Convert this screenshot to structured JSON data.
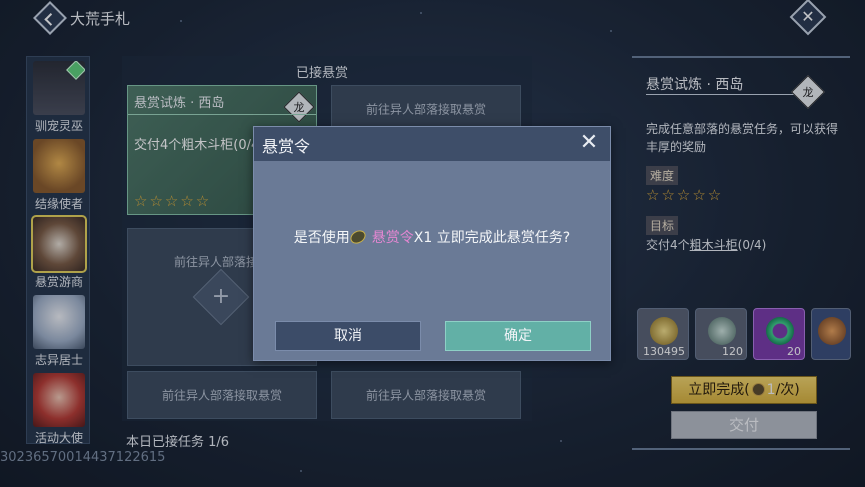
{
  "header": {
    "title": "大荒手札"
  },
  "sidebar": {
    "items": [
      {
        "label": "驯宠灵巫",
        "color": "#3a3d48"
      },
      {
        "label": "结缘使者",
        "color": "#c28a3a"
      },
      {
        "label": "悬赏游商",
        "color": "#8b6a4a"
      },
      {
        "label": "志异居士",
        "color": "#9fb0c8"
      },
      {
        "label": "活动大使",
        "color": "#b83a32"
      }
    ]
  },
  "bounty": {
    "section_title": "已接悬赏",
    "active_card": {
      "title": "悬赏试炼 · 西岛",
      "emblem": "龙",
      "task": "交付4个粗木斗柜(0/4",
      "stars": "☆☆☆☆☆"
    },
    "empty_slot_text": "前往异人部落接取悬赏",
    "empty_slot_text_cut": "前往异人部落接取",
    "plus": "+",
    "daily_count": "本日已接任务 1/6"
  },
  "uid": "3023657001443712261​5",
  "detail": {
    "title": "悬赏试炼 · 西岛",
    "emblem": "龙",
    "description": "完成任意部落的悬赏任务，可以获得丰厚的奖励",
    "difficulty_label": "难度",
    "stars": "☆☆☆☆☆",
    "goal_label": "目标",
    "task_prefix": "交付4个",
    "task_item": "粗木斗柜",
    "task_progress": "(0/4)",
    "rewards": [
      {
        "count": "130495",
        "color": "#c8b04a"
      },
      {
        "count": "120",
        "color": "#6f8f88"
      },
      {
        "count": "20",
        "color": "#3fcf8a"
      },
      {
        "count": "",
        "color": "#a5643a"
      }
    ],
    "complete_label_pre": "立即完成(",
    "complete_label_num": "1",
    "complete_label_post": "/次)",
    "submit_label": "交付"
  },
  "modal": {
    "title": "悬赏令",
    "close": "✕",
    "msg_pre": "是否使用",
    "msg_item": "悬赏令",
    "msg_post": "X1 立即完成此悬赏任务?",
    "cancel": "取消",
    "confirm": "确定"
  }
}
